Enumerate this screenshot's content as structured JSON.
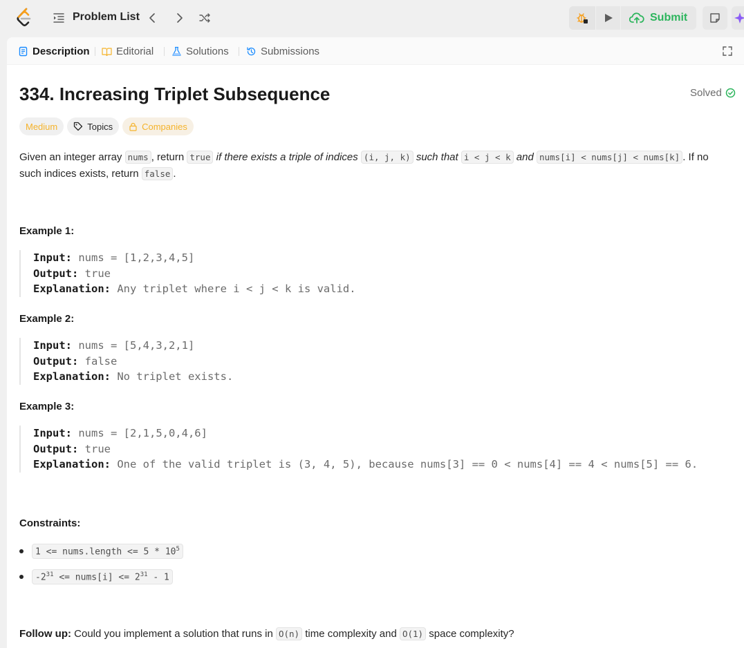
{
  "topbar": {
    "problem_list": "Problem List",
    "submit": "Submit"
  },
  "tabs": [
    {
      "label": "Description"
    },
    {
      "label": "Editorial"
    },
    {
      "label": "Solutions"
    },
    {
      "label": "Submissions"
    }
  ],
  "problem": {
    "title": "334. Increasing Triplet Subsequence",
    "status": "Solved",
    "tags": {
      "difficulty": "Medium",
      "topics": "Topics",
      "companies": "Companies"
    },
    "desc": {
      "p1": "Given an integer array ",
      "c_nums": "nums",
      "p2": ", return ",
      "c_true": "true",
      "p3": " if there exists a triple of indices ",
      "c_ijk": "(i, j, k)",
      "p4": " such that ",
      "c_order": "i < j < k",
      "p5": " and ",
      "c_cond": "nums[i] < nums[j] < nums[k]",
      "p6": ". If no such indices exists, return ",
      "c_false": "false",
      "p7": "."
    }
  },
  "examples": [
    {
      "heading": "Example 1:",
      "input_label": "Input:",
      "input": " nums = [1,2,3,4,5]",
      "output_label": "Output:",
      "output": " true",
      "explanation_label": "Explanation:",
      "explanation": " Any triplet where i < j < k is valid."
    },
    {
      "heading": "Example 2:",
      "input_label": "Input:",
      "input": " nums = [5,4,3,2,1]",
      "output_label": "Output:",
      "output": " false",
      "explanation_label": "Explanation:",
      "explanation": " No triplet exists."
    },
    {
      "heading": "Example 3:",
      "input_label": "Input:",
      "input": " nums = [2,1,5,0,4,6]",
      "output_label": "Output:",
      "output": " true",
      "explanation_label": "Explanation:",
      "explanation": " One of the valid triplet is (3, 4, 5), because nums[3] == 0 < nums[4] == 4 < nums[5] == 6."
    }
  ],
  "constraints": {
    "heading": "Constraints:",
    "c1_a": "1 <= nums.length <= 5 * 10",
    "c1_exp": "5",
    "c2_a": "-2",
    "c2_exp1": "31",
    "c2_b": " <= nums[i] <= 2",
    "c2_exp2": "31",
    "c2_c": " - 1"
  },
  "followup": {
    "label": "Follow up:",
    "t1": " Could you implement a solution that runs in ",
    "c1": "O(n)",
    "t2": " time complexity and ",
    "c2": "O(1)",
    "t3": " space complexity?"
  },
  "colors": {
    "accent_green": "#2db55d",
    "medium_yellow": "#f5b32b",
    "submit_green": "#2db55d"
  }
}
